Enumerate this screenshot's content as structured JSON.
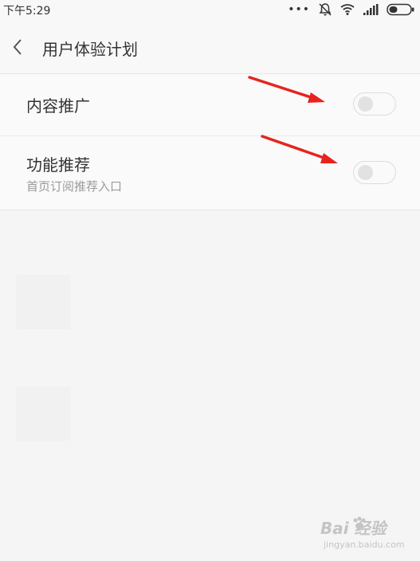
{
  "status_bar": {
    "time": "下午5:29",
    "icons": [
      "more-dots-icon",
      "notification-muted-icon",
      "wifi-icon",
      "signal-icon",
      "battery-icon"
    ],
    "dots": "•••"
  },
  "header": {
    "title": "用户体验计划",
    "back_icon": "chevron-left-icon"
  },
  "settings": [
    {
      "title": "内容推广",
      "subtitle": "",
      "enabled": false
    },
    {
      "title": "功能推荐",
      "subtitle": "首页订阅推荐入口",
      "enabled": false
    }
  ],
  "annotations": {
    "arrow_color": "#e8231e"
  },
  "watermark": {
    "brand": "Bai 经验",
    "url": "jingyan.baidu.com"
  }
}
